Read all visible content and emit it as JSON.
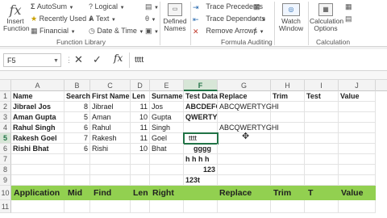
{
  "ribbon": {
    "insert_function": "Insert Function",
    "autosum": "AutoSum",
    "recently_used": "Recently Used",
    "financial": "Financial",
    "logical": "Logical",
    "text": "Text",
    "date_time": "Date & Time",
    "function_library_label": "Function Library",
    "defined_names": "Defined Names",
    "trace_precedents": "Trace Precedents",
    "trace_dependents": "Trace Dependents",
    "remove_arrows": "Remove Arrows",
    "formula_auditing_label": "Formula Auditing",
    "watch_window": "Watch Window",
    "calculation_options": "Calculation Options",
    "calculation_label": "Calculation"
  },
  "formula_bar": {
    "name_box": "F5",
    "content": "tttt"
  },
  "columns": [
    "A",
    "B",
    "C",
    "D",
    "E",
    "F",
    "G",
    "H",
    "I",
    "J"
  ],
  "rows": [
    "1",
    "2",
    "3",
    "4",
    "5",
    "6",
    "7",
    "8",
    "9",
    "10",
    "11"
  ],
  "cells": {
    "A1": "Name",
    "B1": "Search",
    "C1": "First Name",
    "D1": "Len",
    "E1": "Surname",
    "F1": "Test Data",
    "G1": "Replace",
    "H1": "Trim",
    "I1": "Test",
    "J1": "Value",
    "A2": "Jibrael Jos",
    "B2": "8",
    "C2": "Jibrael",
    "D2": "11",
    "E2": "Jos",
    "F2": "ABCDEFGHI",
    "G2": "ABCQWERTYGHI",
    "A3": "Aman Gupta",
    "B3": "5",
    "C3": "Aman",
    "D3": "10",
    "E3": "Gupta",
    "F3": "QWERTY",
    "A4": "Rahul Singh",
    "B4": "6",
    "C4": "Rahul",
    "D4": "11",
    "E4": "Singh",
    "G4": "ABCQWERTYGHI",
    "A5": "Rakesh Goel",
    "B5": "7",
    "C5": "Rakesh",
    "D5": "11",
    "E5": "Goel",
    "F5": "tttt",
    "A6": "Rishi Bhat",
    "B6": "6",
    "C6": "Rishi",
    "D6": "10",
    "E6": "Bhat",
    "F6": "gggg",
    "F7": "h h h h",
    "F8": "123",
    "F9": "123t"
  },
  "row10": {
    "application": "Application",
    "mid": "Mid",
    "find": "Find",
    "len": "Len",
    "right": "Right",
    "replace": "Replace",
    "trim": "Trim",
    "t": "T",
    "value": "Value"
  },
  "colors": {
    "header_green": "#92d050",
    "excel_green": "#217346"
  }
}
